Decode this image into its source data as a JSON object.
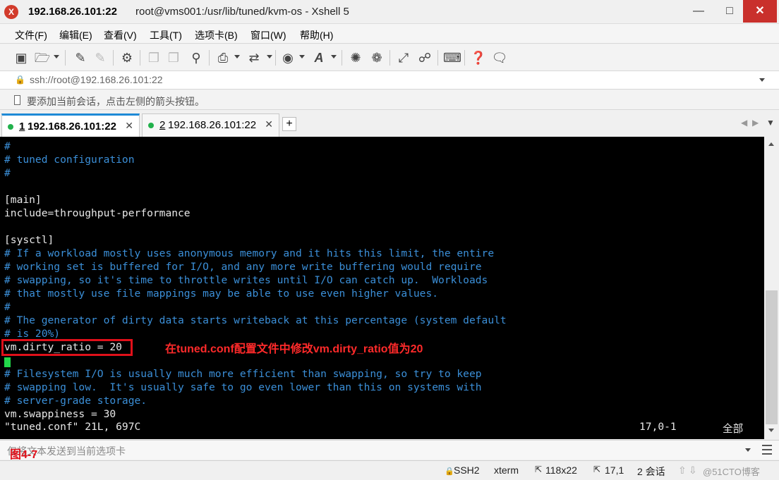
{
  "window": {
    "title_host": "192.168.26.101:22",
    "title_rest": "root@vms001:/usr/lib/tuned/kvm-os - Xshell 5"
  },
  "menu": [
    "文件(F)",
    "编辑(E)",
    "查看(V)",
    "工具(T)",
    "选项卡(B)",
    "窗口(W)",
    "帮助(H)"
  ],
  "toolbar_icons": [
    "new-session-icon",
    "open-folder-icon",
    "reconnect-icon",
    "disconnect-icon",
    "properties-icon",
    "copy-icon",
    "paste-icon",
    "find-icon",
    "print-icon",
    "transfer-icon",
    "globe-icon",
    "font-icon",
    "xftp-icon",
    "xmanager-icon",
    "fullscreen-icon",
    "lock-icon",
    "keyboard-icon",
    "help-icon",
    "chat-icon"
  ],
  "address": {
    "value": "ssh://root@192.168.26.101:22"
  },
  "hint": {
    "text": "要添加当前会话，点击左侧的箭头按钮。"
  },
  "tabs": [
    {
      "num": "1",
      "host": "192.168.26.101:22",
      "status_color": "#22b14c"
    },
    {
      "num": "2",
      "host": "192.168.26.101:22",
      "status_color": "#22b14c"
    }
  ],
  "terminal": {
    "lines": [
      {
        "text": "#",
        "kind": "comment"
      },
      {
        "text": "# tuned configuration",
        "kind": "comment"
      },
      {
        "text": "#",
        "kind": "comment"
      },
      {
        "text": "",
        "kind": "normal"
      },
      {
        "text": "[main]",
        "kind": "normal"
      },
      {
        "text": "include=throughput-performance",
        "kind": "normal"
      },
      {
        "text": "",
        "kind": "normal"
      },
      {
        "text": "[sysctl]",
        "kind": "normal"
      },
      {
        "text": "# If a workload mostly uses anonymous memory and it hits this limit, the entire",
        "kind": "comment"
      },
      {
        "text": "# working set is buffered for I/O, and any more write buffering would require",
        "kind": "comment"
      },
      {
        "text": "# swapping, so it's time to throttle writes until I/O can catch up.  Workloads",
        "kind": "comment"
      },
      {
        "text": "# that mostly use file mappings may be able to use even higher values.",
        "kind": "comment"
      },
      {
        "text": "#",
        "kind": "comment"
      },
      {
        "text": "# The generator of dirty data starts writeback at this percentage (system default",
        "kind": "comment"
      },
      {
        "text": "# is 20%)",
        "kind": "comment"
      },
      {
        "text": "vm.dirty_ratio = 20",
        "kind": "normal"
      },
      {
        "text": "",
        "kind": "normal"
      },
      {
        "text": "# Filesystem I/O is usually much more efficient than swapping, so try to keep",
        "kind": "comment"
      },
      {
        "text": "# swapping low.  It's usually safe to go even lower than this on systems with",
        "kind": "comment"
      },
      {
        "text": "# server-grade storage.",
        "kind": "comment"
      },
      {
        "text": "vm.swappiness = 30",
        "kind": "normal"
      }
    ],
    "status_file": "\"tuned.conf\" 21L, 697C",
    "status_pos": "17,0-1",
    "status_all": "全部",
    "annotation": "在tuned.conf配置文件中修改vm.dirty_ratio值为20",
    "colors": {
      "comment": "#3b8fd8",
      "normal": "#e8e8e8",
      "cursor": "#22d84a",
      "highlight": "#e0101a"
    }
  },
  "send_bar": {
    "placeholder": "仅将文本发送到当前选项卡",
    "figure_label": "图4-7"
  },
  "statusbar": {
    "protocol": "SSH2",
    "terminal_type": "xterm",
    "size": "118x22",
    "cursor_pos": "17,1",
    "sessions": "2 会话",
    "watermark": "@51CTO博客"
  }
}
